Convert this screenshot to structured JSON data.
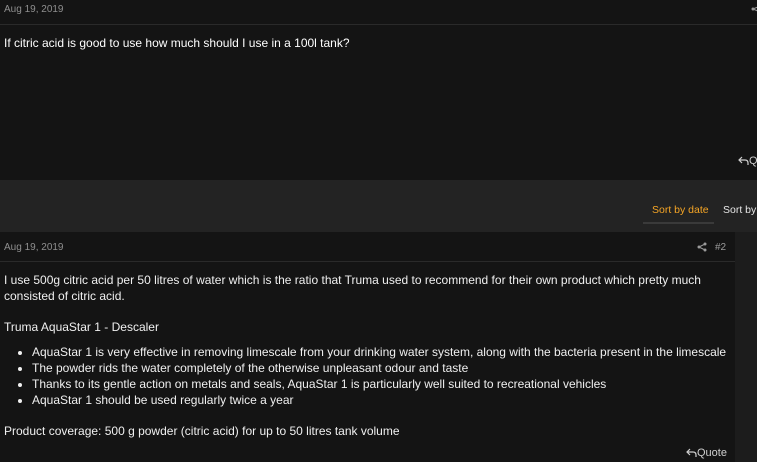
{
  "post1": {
    "date": "Aug 19, 2019",
    "text": "If citric acid is good to use how much should I use in a 100l tank?",
    "reply_label": "Q"
  },
  "sort": {
    "active": "Sort by date",
    "other": "Sort by"
  },
  "post2": {
    "date": "Aug 19, 2019",
    "number": "#2",
    "paragraph1": "I use 500g citric acid per 50 litres of water which is the ratio that Truma used to recommend for their own product which pretty much consisted of citric acid.",
    "product_title": "Truma AquaStar 1 - Descaler",
    "bullets": [
      "AquaStar 1 is very effective in removing limescale from your drinking water system, along with the bacteria present in the limescale",
      "The powder rids the water completely of the otherwise unpleasant odour and taste",
      "Thanks to its gentle action on metals and seals, AquaStar 1 is particularly well suited to recreational vehicles",
      "AquaStar 1 should be used regularly twice a year"
    ],
    "coverage": "Product coverage: 500 g powder (citric acid) for up to 50 litres tank volume",
    "quote_label": "Quote"
  },
  "icons": {
    "share": "share-icon",
    "reply": "reply-arrow-icon"
  },
  "colors": {
    "background": "#141414",
    "sort_band": "#232323",
    "accent": "#f5a525"
  }
}
